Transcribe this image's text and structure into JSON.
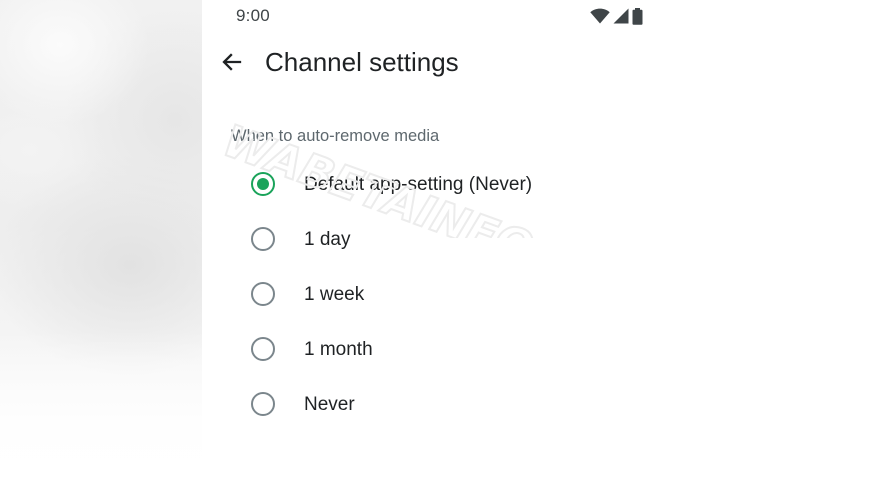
{
  "status_bar": {
    "time": "9:00",
    "icons": [
      "wifi-icon",
      "signal-icon",
      "battery-icon"
    ]
  },
  "header": {
    "back_icon": "arrow-left-icon",
    "title": "Channel settings"
  },
  "section": {
    "title": "When to auto-remove media"
  },
  "options": [
    {
      "label": "Default app-setting (Never)",
      "selected": true
    },
    {
      "label": "1 day",
      "selected": false
    },
    {
      "label": "1 week",
      "selected": false
    },
    {
      "label": "1 month",
      "selected": false
    },
    {
      "label": "Never",
      "selected": false
    }
  ],
  "watermark": {
    "text": "WABETAINFO"
  },
  "colors": {
    "accent": "#1aa35a",
    "text_primary": "#1f2224",
    "text_secondary": "#5e686e",
    "radio_unselected": "#7b868c"
  }
}
